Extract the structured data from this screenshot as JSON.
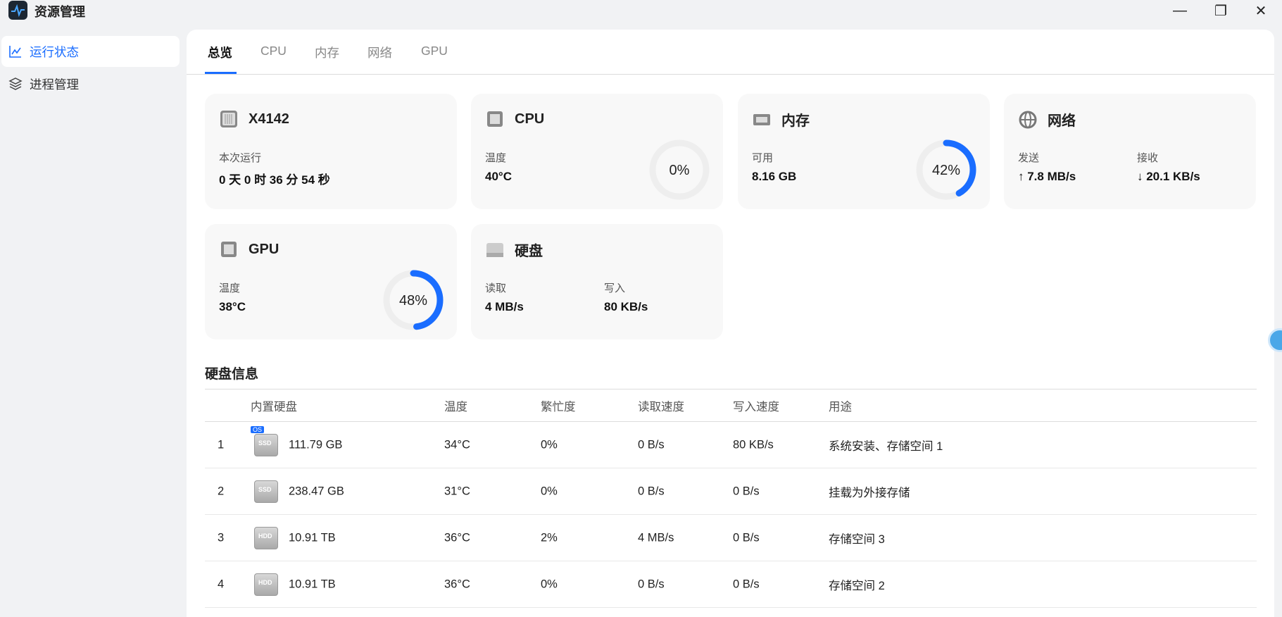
{
  "app": {
    "title": "资源管理"
  },
  "window": {
    "minimize": "—",
    "maximize": "❐",
    "close": "✕"
  },
  "sidebar": {
    "items": [
      {
        "label": "运行状态",
        "icon": "chart-line-icon",
        "active": true
      },
      {
        "label": "进程管理",
        "icon": "layers-icon",
        "active": false
      }
    ]
  },
  "tabs": [
    {
      "label": "总览"
    },
    {
      "label": "CPU"
    },
    {
      "label": "内存"
    },
    {
      "label": "网络"
    },
    {
      "label": "GPU"
    }
  ],
  "cards": {
    "device": {
      "title": "X4142",
      "label": "本次运行",
      "value": "0 天 0 时 36 分 54 秒"
    },
    "cpu": {
      "title": "CPU",
      "label": "温度",
      "value": "40°C",
      "usage": 0,
      "usage_text": "0%"
    },
    "memory": {
      "title": "内存",
      "label": "可用",
      "value": "8.16 GB",
      "usage": 42,
      "usage_text": "42%"
    },
    "network": {
      "title": "网络",
      "send_label": "发送",
      "send_value": "↑ 7.8 MB/s",
      "recv_label": "接收",
      "recv_value": "↓ 20.1 KB/s"
    },
    "gpu": {
      "title": "GPU",
      "label": "温度",
      "value": "38°C",
      "usage": 48,
      "usage_text": "48%"
    },
    "disk": {
      "title": "硬盘",
      "read_label": "读取",
      "read_value": "4 MB/s",
      "write_label": "写入",
      "write_value": "80 KB/s"
    }
  },
  "disks": {
    "title": "硬盘信息",
    "headers": [
      "内置硬盘",
      "温度",
      "繁忙度",
      "读取速度",
      "写入速度",
      "用途"
    ],
    "rows": [
      {
        "index": "1",
        "type": "SSD",
        "os": "OS",
        "size": "111.79 GB",
        "temp": "34°C",
        "busy": "0%",
        "read": "0 B/s",
        "write": "80 KB/s",
        "usage": "系统安装、存储空间 1"
      },
      {
        "index": "2",
        "type": "SSD",
        "size": "238.47 GB",
        "temp": "31°C",
        "busy": "0%",
        "read": "0 B/s",
        "write": "0 B/s",
        "usage": "挂载为外接存储"
      },
      {
        "index": "3",
        "type": "HDD",
        "size": "10.91 TB",
        "temp": "36°C",
        "busy": "2%",
        "read": "4 MB/s",
        "write": "0 B/s",
        "usage": "存储空间 3"
      },
      {
        "index": "4",
        "type": "HDD",
        "size": "10.91 TB",
        "temp": "36°C",
        "busy": "0%",
        "read": "0 B/s",
        "write": "0 B/s",
        "usage": "存储空间 2"
      }
    ]
  },
  "colors": {
    "accent": "#1a6dff",
    "track": "#eeeeee"
  }
}
